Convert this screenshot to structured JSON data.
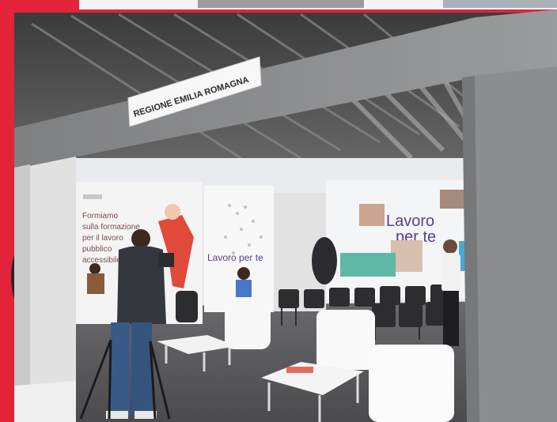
{
  "sign": {
    "text": "REGIONE EMILIA ROMAGNA"
  },
  "posters": {
    "left_title": "Lavoro per te",
    "right_title_line1": "Lavoro",
    "right_title_line2": "per te",
    "side_text_lines": [
      "Formiamo",
      "sulla formazione",
      "per il lavoro",
      "pubblico",
      "accessibile"
    ]
  },
  "colors": {
    "frame": "#e2233a",
    "ceiling": "#4a4a4a",
    "floor": "#5c5b5e",
    "arch": "#8a8b8d",
    "wall": "#eef0f2",
    "accent_red": "#e04a3a",
    "accent_teal": "#5fb7a6"
  }
}
